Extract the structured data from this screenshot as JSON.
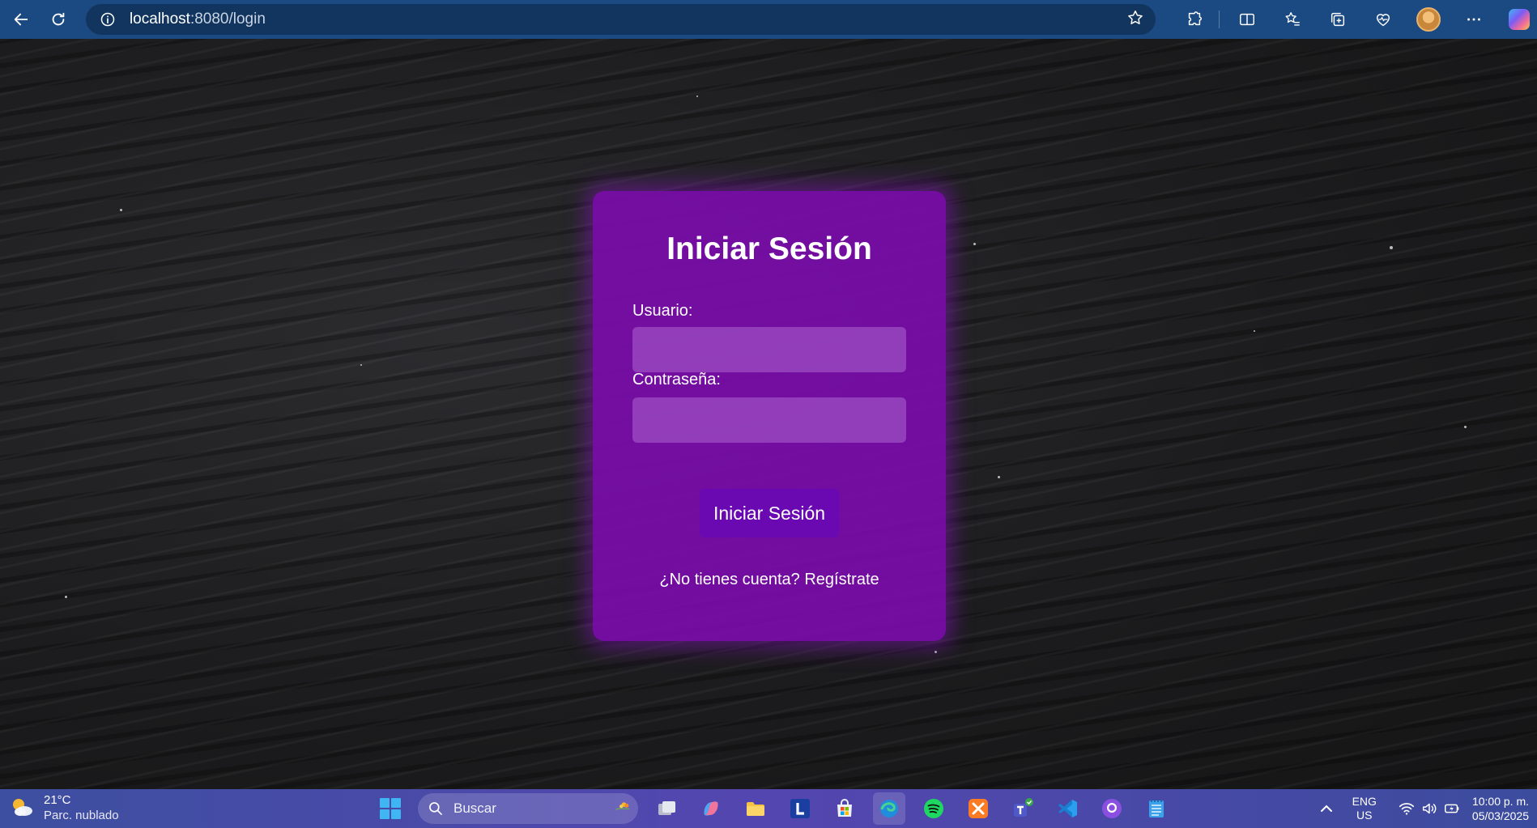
{
  "browser": {
    "url_host": "localhost",
    "url_rest": ":8080/login"
  },
  "login": {
    "title": "Iniciar Sesión",
    "username_label": "Usuario:",
    "username_value": "",
    "password_label": "Contraseña:",
    "password_value": "",
    "submit_label": "Iniciar Sesión",
    "register_link": "¿No tienes cuenta? Regístrate"
  },
  "taskbar": {
    "weather_temp": "21°C",
    "weather_desc": "Parc. nublado",
    "search_label": "Buscar",
    "lang_primary": "ENG",
    "lang_secondary": "US",
    "time": "10:00 p. m.",
    "date": "05/03/2025",
    "apps": [
      "task-view",
      "copilot",
      "file-explorer",
      "l-app",
      "microsoft-store",
      "edge",
      "spotify",
      "xampp",
      "teams",
      "vscode",
      "github-desktop",
      "notepad"
    ]
  },
  "colors": {
    "browser_bar": "#1b4a83",
    "card": "#7a0caa",
    "button": "#6a09b2",
    "taskbar": "#4a4aa8"
  }
}
